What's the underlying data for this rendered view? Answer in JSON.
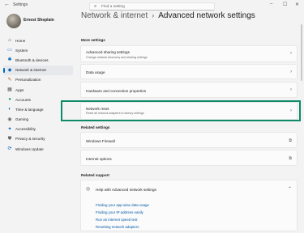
{
  "window": {
    "title": "Settings",
    "back_glyph": "←",
    "controls": {
      "minimize": "–",
      "maximize": "☐",
      "close": "✕"
    }
  },
  "search": {
    "placeholder": "Find a setting",
    "icon": "search-icon"
  },
  "profile": {
    "name": "Ernest Sheplain"
  },
  "sidebar": {
    "items": [
      {
        "label": "Home",
        "icon": "home-icon",
        "glyph": "⌂",
        "color": "#444444"
      },
      {
        "label": "System",
        "icon": "system-icon",
        "glyph": "▭",
        "color": "#0067c0"
      },
      {
        "label": "Bluetooth & devices",
        "icon": "bluetooth-icon",
        "glyph": "✱",
        "color": "#0067c0"
      },
      {
        "label": "Network & internet",
        "icon": "network-icon",
        "glyph": "◆",
        "color": "#0067c0",
        "active": true
      },
      {
        "label": "Personalization",
        "icon": "brush-icon",
        "glyph": "✎",
        "color": "#c05a2a"
      },
      {
        "label": "Apps",
        "icon": "apps-icon",
        "glyph": "▦",
        "color": "#555555"
      },
      {
        "label": "Accounts",
        "icon": "accounts-icon",
        "glyph": "●",
        "color": "#2a9d60"
      },
      {
        "label": "Time & language",
        "icon": "globe-icon",
        "glyph": "◐",
        "color": "#0067c0"
      },
      {
        "label": "Gaming",
        "icon": "gaming-icon",
        "glyph": "◉",
        "color": "#666666"
      },
      {
        "label": "Accessibility",
        "icon": "accessibility-icon",
        "glyph": "✦",
        "color": "#0067c0"
      },
      {
        "label": "Privacy & security",
        "icon": "shield-icon",
        "glyph": "⛊",
        "color": "#666666"
      },
      {
        "label": "Windows Update",
        "icon": "update-icon",
        "glyph": "⟳",
        "color": "#0067c0"
      }
    ]
  },
  "header": {
    "crumb": "Network & internet",
    "separator": "›",
    "title": "Advanced network settings"
  },
  "more_settings": {
    "heading": "More settings",
    "items": [
      {
        "title": "Advanced sharing settings",
        "subtitle": "Change network discovery and sharing settings"
      },
      {
        "title": "Data usage",
        "subtitle": ""
      },
      {
        "title": "Hardware and connection properties",
        "subtitle": ""
      },
      {
        "title": "Network reset",
        "subtitle": "Reset all network adapters to factory settings"
      }
    ]
  },
  "related_settings": {
    "heading": "Related settings",
    "items": [
      {
        "title": "Windows Firewall"
      },
      {
        "title": "Internet options"
      }
    ]
  },
  "related_support": {
    "heading": "Related support",
    "header_label": "Help with Advanced network settings",
    "links": [
      "Finding your app-wise data usage",
      "Finding your IP address easily",
      "Run an internet speed test",
      "Resetting network adapters"
    ]
  },
  "glyphs": {
    "chevron": "›",
    "external": "⧉",
    "collapse": "⌃",
    "help": "◎"
  },
  "colors": {
    "accent": "#0067c0",
    "highlight_border": "#0e8a68"
  }
}
